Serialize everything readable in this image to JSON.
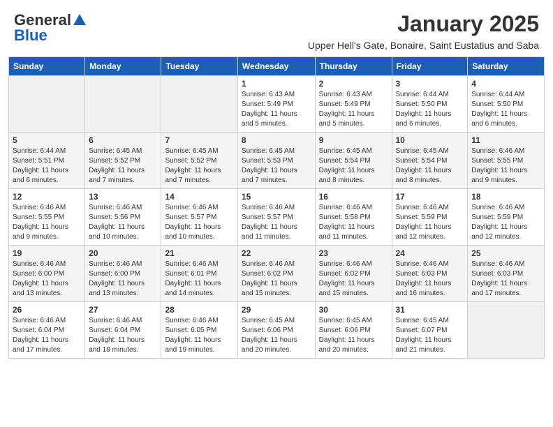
{
  "header": {
    "logo_line1": "General",
    "logo_line2": "Blue",
    "month": "January 2025",
    "subtitle": "Upper Hell's Gate, Bonaire, Saint Eustatius and Saba"
  },
  "days_of_week": [
    "Sunday",
    "Monday",
    "Tuesday",
    "Wednesday",
    "Thursday",
    "Friday",
    "Saturday"
  ],
  "weeks": [
    [
      {
        "day": "",
        "info": ""
      },
      {
        "day": "",
        "info": ""
      },
      {
        "day": "",
        "info": ""
      },
      {
        "day": "1",
        "info": "Sunrise: 6:43 AM\nSunset: 5:49 PM\nDaylight: 11 hours\nand 5 minutes."
      },
      {
        "day": "2",
        "info": "Sunrise: 6:43 AM\nSunset: 5:49 PM\nDaylight: 11 hours\nand 5 minutes."
      },
      {
        "day": "3",
        "info": "Sunrise: 6:44 AM\nSunset: 5:50 PM\nDaylight: 11 hours\nand 6 minutes."
      },
      {
        "day": "4",
        "info": "Sunrise: 6:44 AM\nSunset: 5:50 PM\nDaylight: 11 hours\nand 6 minutes."
      }
    ],
    [
      {
        "day": "5",
        "info": "Sunrise: 6:44 AM\nSunset: 5:51 PM\nDaylight: 11 hours\nand 6 minutes."
      },
      {
        "day": "6",
        "info": "Sunrise: 6:45 AM\nSunset: 5:52 PM\nDaylight: 11 hours\nand 7 minutes."
      },
      {
        "day": "7",
        "info": "Sunrise: 6:45 AM\nSunset: 5:52 PM\nDaylight: 11 hours\nand 7 minutes."
      },
      {
        "day": "8",
        "info": "Sunrise: 6:45 AM\nSunset: 5:53 PM\nDaylight: 11 hours\nand 7 minutes."
      },
      {
        "day": "9",
        "info": "Sunrise: 6:45 AM\nSunset: 5:54 PM\nDaylight: 11 hours\nand 8 minutes."
      },
      {
        "day": "10",
        "info": "Sunrise: 6:45 AM\nSunset: 5:54 PM\nDaylight: 11 hours\nand 8 minutes."
      },
      {
        "day": "11",
        "info": "Sunrise: 6:46 AM\nSunset: 5:55 PM\nDaylight: 11 hours\nand 9 minutes."
      }
    ],
    [
      {
        "day": "12",
        "info": "Sunrise: 6:46 AM\nSunset: 5:55 PM\nDaylight: 11 hours\nand 9 minutes."
      },
      {
        "day": "13",
        "info": "Sunrise: 6:46 AM\nSunset: 5:56 PM\nDaylight: 11 hours\nand 10 minutes."
      },
      {
        "day": "14",
        "info": "Sunrise: 6:46 AM\nSunset: 5:57 PM\nDaylight: 11 hours\nand 10 minutes."
      },
      {
        "day": "15",
        "info": "Sunrise: 6:46 AM\nSunset: 5:57 PM\nDaylight: 11 hours\nand 11 minutes."
      },
      {
        "day": "16",
        "info": "Sunrise: 6:46 AM\nSunset: 5:58 PM\nDaylight: 11 hours\nand 11 minutes."
      },
      {
        "day": "17",
        "info": "Sunrise: 6:46 AM\nSunset: 5:59 PM\nDaylight: 11 hours\nand 12 minutes."
      },
      {
        "day": "18",
        "info": "Sunrise: 6:46 AM\nSunset: 5:59 PM\nDaylight: 11 hours\nand 12 minutes."
      }
    ],
    [
      {
        "day": "19",
        "info": "Sunrise: 6:46 AM\nSunset: 6:00 PM\nDaylight: 11 hours\nand 13 minutes."
      },
      {
        "day": "20",
        "info": "Sunrise: 6:46 AM\nSunset: 6:00 PM\nDaylight: 11 hours\nand 13 minutes."
      },
      {
        "day": "21",
        "info": "Sunrise: 6:46 AM\nSunset: 6:01 PM\nDaylight: 11 hours\nand 14 minutes."
      },
      {
        "day": "22",
        "info": "Sunrise: 6:46 AM\nSunset: 6:02 PM\nDaylight: 11 hours\nand 15 minutes."
      },
      {
        "day": "23",
        "info": "Sunrise: 6:46 AM\nSunset: 6:02 PM\nDaylight: 11 hours\nand 15 minutes."
      },
      {
        "day": "24",
        "info": "Sunrise: 6:46 AM\nSunset: 6:03 PM\nDaylight: 11 hours\nand 16 minutes."
      },
      {
        "day": "25",
        "info": "Sunrise: 6:46 AM\nSunset: 6:03 PM\nDaylight: 11 hours\nand 17 minutes."
      }
    ],
    [
      {
        "day": "26",
        "info": "Sunrise: 6:46 AM\nSunset: 6:04 PM\nDaylight: 11 hours\nand 17 minutes."
      },
      {
        "day": "27",
        "info": "Sunrise: 6:46 AM\nSunset: 6:04 PM\nDaylight: 11 hours\nand 18 minutes."
      },
      {
        "day": "28",
        "info": "Sunrise: 6:46 AM\nSunset: 6:05 PM\nDaylight: 11 hours\nand 19 minutes."
      },
      {
        "day": "29",
        "info": "Sunrise: 6:45 AM\nSunset: 6:06 PM\nDaylight: 11 hours\nand 20 minutes."
      },
      {
        "day": "30",
        "info": "Sunrise: 6:45 AM\nSunset: 6:06 PM\nDaylight: 11 hours\nand 20 minutes."
      },
      {
        "day": "31",
        "info": "Sunrise: 6:45 AM\nSunset: 6:07 PM\nDaylight: 11 hours\nand 21 minutes."
      },
      {
        "day": "",
        "info": ""
      }
    ]
  ]
}
